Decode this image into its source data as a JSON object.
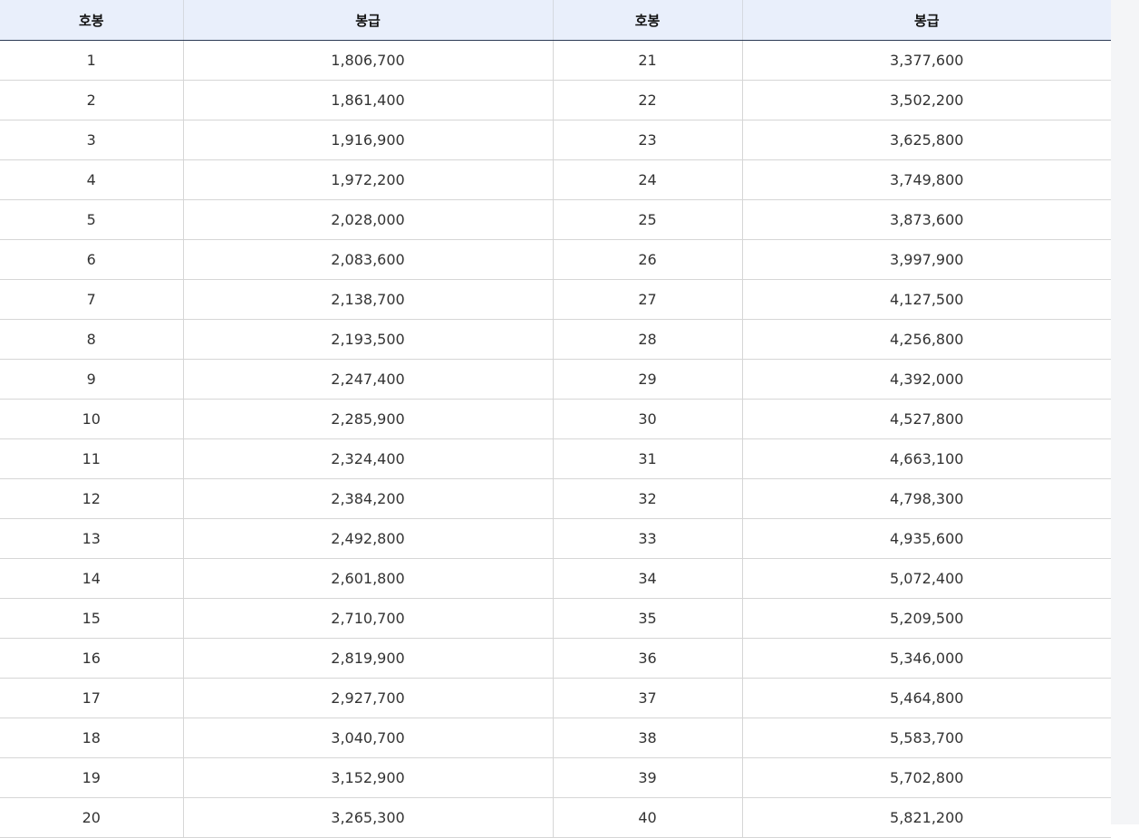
{
  "table": {
    "headers": [
      "호봉",
      "봉급",
      "호봉",
      "봉급"
    ],
    "rows": [
      [
        "1",
        "1,806,700",
        "21",
        "3,377,600"
      ],
      [
        "2",
        "1,861,400",
        "22",
        "3,502,200"
      ],
      [
        "3",
        "1,916,900",
        "23",
        "3,625,800"
      ],
      [
        "4",
        "1,972,200",
        "24",
        "3,749,800"
      ],
      [
        "5",
        "2,028,000",
        "25",
        "3,873,600"
      ],
      [
        "6",
        "2,083,600",
        "26",
        "3,997,900"
      ],
      [
        "7",
        "2,138,700",
        "27",
        "4,127,500"
      ],
      [
        "8",
        "2,193,500",
        "28",
        "4,256,800"
      ],
      [
        "9",
        "2,247,400",
        "29",
        "4,392,000"
      ],
      [
        "10",
        "2,285,900",
        "30",
        "4,527,800"
      ],
      [
        "11",
        "2,324,400",
        "31",
        "4,663,100"
      ],
      [
        "12",
        "2,384,200",
        "32",
        "4,798,300"
      ],
      [
        "13",
        "2,492,800",
        "33",
        "4,935,600"
      ],
      [
        "14",
        "2,601,800",
        "34",
        "5,072,400"
      ],
      [
        "15",
        "2,710,700",
        "35",
        "5,209,500"
      ],
      [
        "16",
        "2,819,900",
        "36",
        "5,346,000"
      ],
      [
        "17",
        "2,927,700",
        "37",
        "5,464,800"
      ],
      [
        "18",
        "3,040,700",
        "38",
        "5,583,700"
      ],
      [
        "19",
        "3,152,900",
        "39",
        "5,702,800"
      ],
      [
        "20",
        "3,265,300",
        "40",
        "5,821,200"
      ]
    ]
  }
}
